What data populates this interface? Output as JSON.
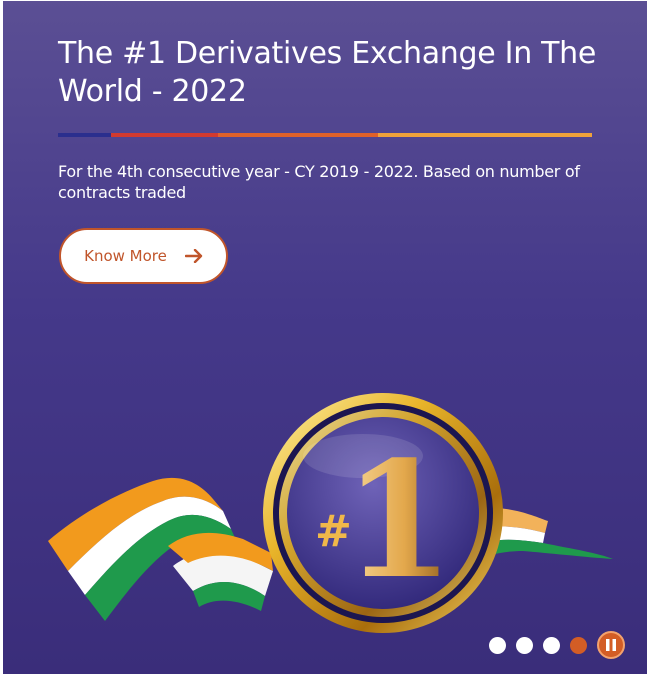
{
  "banner": {
    "title": "The #1 Derivatives Exchange In The World - 2022",
    "subtitle": "For the 4th consecutive year - CY 2019 - 2022. Based on number of contracts traded",
    "cta_label": "Know More",
    "divider_colors": [
      "#2b2f8e",
      "#d23a2f",
      "#e0612a",
      "#f0a23a"
    ],
    "medal_text": "#1",
    "icons": {
      "cta_arrow": "arrow-right-icon",
      "pause": "pause-icon"
    }
  },
  "carousel": {
    "slide_count": 4,
    "active_index": 3,
    "accent_color": "#d35d25"
  }
}
